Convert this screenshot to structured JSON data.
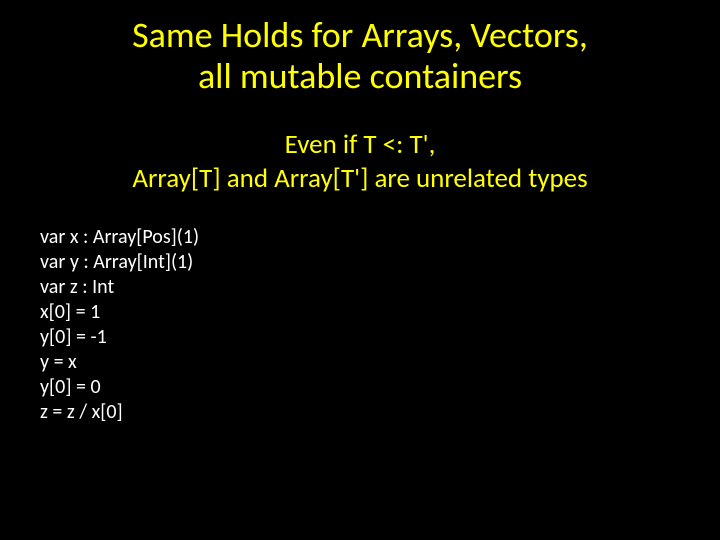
{
  "title": {
    "line1": "Same Holds for Arrays, Vectors,",
    "line2": "all mutable containers"
  },
  "subtitle": {
    "line1": "Even if T <: T',",
    "line2": "Array[T] and Array[T'] are unrelated types"
  },
  "code": {
    "line1": "var x : Array[Pos](1)",
    "line2": "var y : Array[Int](1)",
    "line3": "var z : Int",
    "line4": "x[0] = 1",
    "line5": "y[0] = -1",
    "line6": "y = x",
    "line7": "y[0] = 0",
    "line8": "z = z / x[0]"
  }
}
